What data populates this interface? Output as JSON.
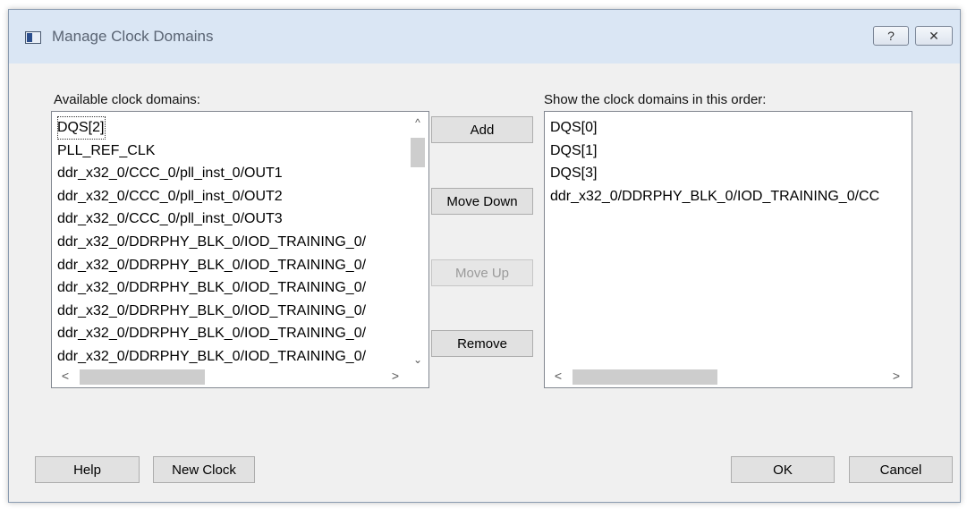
{
  "window": {
    "title": "Manage Clock Domains",
    "help_glyph": "?",
    "close_glyph": "✕"
  },
  "available": {
    "label": "Available clock domains:",
    "items": [
      "DQS[2]",
      "PLL_REF_CLK",
      "ddr_x32_0/CCC_0/pll_inst_0/OUT1",
      "ddr_x32_0/CCC_0/pll_inst_0/OUT2",
      "ddr_x32_0/CCC_0/pll_inst_0/OUT3",
      "ddr_x32_0/DDRPHY_BLK_0/IOD_TRAINING_0/",
      "ddr_x32_0/DDRPHY_BLK_0/IOD_TRAINING_0/",
      "ddr_x32_0/DDRPHY_BLK_0/IOD_TRAINING_0/",
      "ddr_x32_0/DDRPHY_BLK_0/IOD_TRAINING_0/",
      "ddr_x32_0/DDRPHY_BLK_0/IOD_TRAINING_0/",
      "ddr_x32_0/DDRPHY_BLK_0/IOD_TRAINING_0/"
    ]
  },
  "ordered": {
    "label": "Show the clock domains in this order:",
    "items": [
      "DQS[0]",
      "DQS[1]",
      "DQS[3]",
      "ddr_x32_0/DDRPHY_BLK_0/IOD_TRAINING_0/CC"
    ]
  },
  "middle_buttons": {
    "add": "Add",
    "move_down": "Move Down",
    "move_up": "Move Up",
    "remove": "Remove"
  },
  "footer": {
    "help": "Help",
    "new_clock": "New Clock",
    "ok": "OK",
    "cancel": "Cancel"
  },
  "scroll_glyphs": {
    "up": "^",
    "down": "⌄",
    "left": "<",
    "right": ">"
  },
  "colors": {
    "titlebar": "#dae6f4",
    "dialog_bg": "#f0f0f0",
    "button_bg": "#e1e1e1",
    "disabled_text": "#9a9a9a"
  }
}
